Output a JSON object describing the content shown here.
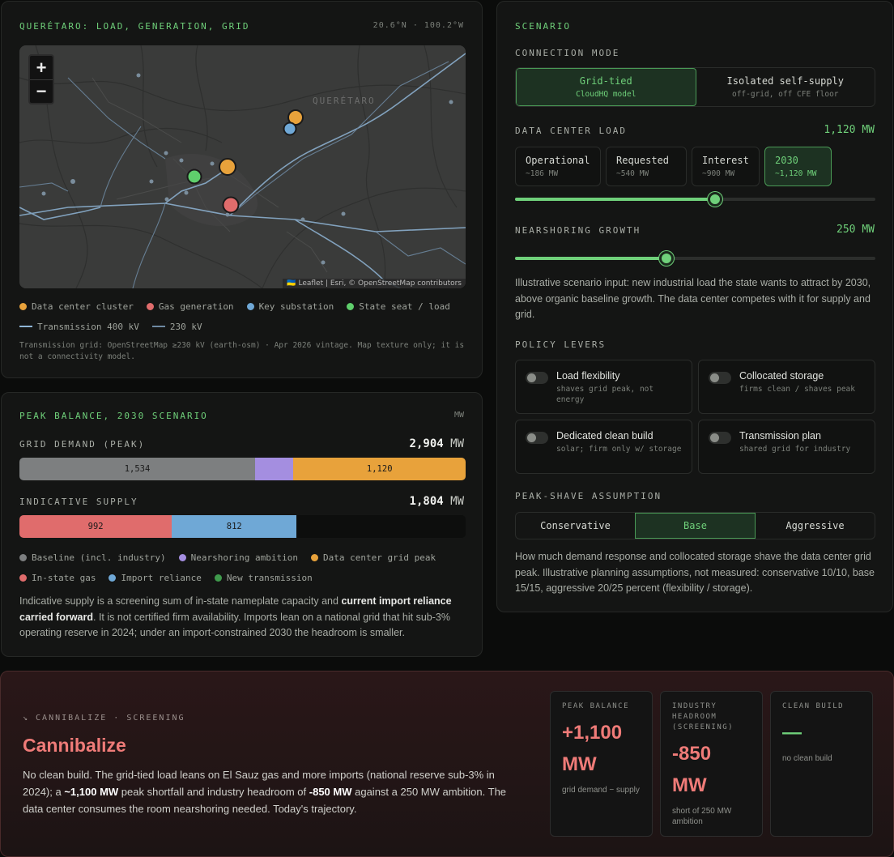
{
  "map_panel": {
    "title": "QUERÉTARO: LOAD, GENERATION, GRID",
    "coords": "20.6°N · 100.2°W",
    "map_place_label": "QUERÉTARO",
    "zoom_in": "+",
    "zoom_out": "−",
    "attribution": "🇺🇦 Leaflet | Esri, © OpenStreetMap contributors",
    "legend": [
      {
        "label": "Data center cluster",
        "color": "#e8a23b"
      },
      {
        "label": "Gas generation",
        "color": "#e06c6c"
      },
      {
        "label": "Key substation",
        "color": "#6fa8d6"
      },
      {
        "label": "State seat / load",
        "color": "#5fcf6c"
      }
    ],
    "line_legend": [
      {
        "label": "Transmission 400 kV",
        "color": "#8fb5d6"
      },
      {
        "label": "230 kV",
        "color": "#6e8aa3"
      }
    ],
    "note": "Transmission grid: OpenStreetMap ≥230 kV (earth-osm) · Apr 2026 vintage. Map texture only; it is not a connectivity model."
  },
  "peak_panel": {
    "title": "PEAK BALANCE, 2030 SCENARIO",
    "unit": "MW",
    "demand_label": "GRID DEMAND (PEAK)",
    "demand_total": "2,904",
    "demand_unit": "MW",
    "demand_segments": [
      {
        "name": "Baseline (incl. industry)",
        "value": 1534,
        "label": "1,534",
        "color": "#7d7f80"
      },
      {
        "name": "Nearshoring ambition",
        "value": 250,
        "label": "",
        "color": "#a48ee0"
      },
      {
        "name": "Data center grid peak",
        "value": 1120,
        "label": "1,120",
        "color": "#e8a23b"
      }
    ],
    "demand_scale_max": 2904,
    "supply_label": "INDICATIVE SUPPLY",
    "supply_total": "1,804",
    "supply_unit": "MW",
    "supply_segments": [
      {
        "name": "In-state gas",
        "value": 992,
        "label": "992",
        "color": "#e06c6c"
      },
      {
        "name": "Import reliance",
        "value": 812,
        "label": "812",
        "color": "#6fa8d6"
      }
    ],
    "legend_row1": [
      {
        "label": "Baseline (incl. industry)",
        "color": "#7d7f80"
      },
      {
        "label": "Nearshoring ambition",
        "color": "#a48ee0"
      },
      {
        "label": "Data center grid peak",
        "color": "#e8a23b"
      }
    ],
    "legend_row2": [
      {
        "label": "In-state gas",
        "color": "#e06c6c"
      },
      {
        "label": "Import reliance",
        "color": "#6fa8d6"
      },
      {
        "label": "New transmission",
        "color": "#3f9a4c"
      }
    ],
    "para_pre": "Indicative supply is a screening sum of in-state nameplate capacity and ",
    "para_bold": "current import reliance carried forward",
    "para_post": ". It is not certified firm availability. Imports lean on a national grid that hit sub-3% operating reserve in 2024; under an import-constrained 2030 the headroom is smaller."
  },
  "scenario": {
    "title": "SCENARIO",
    "connection_label": "CONNECTION MODE",
    "connection_options": [
      {
        "title": "Grid-tied",
        "sub": "CloudHQ model",
        "active": true
      },
      {
        "title": "Isolated self-supply",
        "sub": "off-grid, off CFE floor",
        "active": false
      }
    ],
    "load_label": "DATA CENTER LOAD",
    "load_value": "1,120 MW",
    "load_options": [
      {
        "title": "Operational",
        "sub": "~186 MW",
        "active": false
      },
      {
        "title": "Requested",
        "sub": "~540 MW",
        "active": false
      },
      {
        "title": "Interest",
        "sub": "~900 MW",
        "active": false
      },
      {
        "title": "2030",
        "sub": "~1,120 MW",
        "active": true
      }
    ],
    "load_slider_fraction": 0.555,
    "nearshoring_label": "NEARSHORING GROWTH",
    "nearshoring_value": "250 MW",
    "nearshoring_slider_fraction": 0.42,
    "nearshoring_desc": "Illustrative scenario input: new industrial load the state wants to attract by 2030, above organic baseline growth. The data center competes with it for supply and grid.",
    "levers_label": "POLICY LEVERS",
    "levers": [
      {
        "title": "Load flexibility",
        "sub": "shaves grid peak, not energy",
        "on": false
      },
      {
        "title": "Collocated storage",
        "sub": "firms clean / shaves peak",
        "on": false
      },
      {
        "title": "Dedicated clean build",
        "sub": "solar; firm only w/ storage",
        "on": false
      },
      {
        "title": "Transmission plan",
        "sub": "shared grid for industry",
        "on": false
      }
    ],
    "shave_label": "PEAK-SHAVE ASSUMPTION",
    "shave_options": [
      {
        "label": "Conservative",
        "active": false
      },
      {
        "label": "Base",
        "active": true
      },
      {
        "label": "Aggressive",
        "active": false
      }
    ],
    "shave_desc": "How much demand response and collocated storage shave the data center grid peak. Illustrative planning assumptions, not measured: conservative 10/10, base 15/15, aggressive 20/25 percent (flexibility / storage)."
  },
  "verdict": {
    "tag": "↘ CANNIBALIZE · SCREENING",
    "title": "Cannibalize",
    "desc_1": "No clean build. The grid-tied load leans on El Sauz gas and more imports (national reserve sub-3% in 2024); a ",
    "desc_b1": "~1,100 MW",
    "desc_2": " peak shortfall and industry headroom of ",
    "desc_b2": "-850 MW",
    "desc_3": " against a 250 MW ambition. The data center consumes the room nearshoring needed. Today's trajectory.",
    "stats": [
      {
        "head": "PEAK BALANCE",
        "value": "+1,100 MW",
        "sub": "grid demand − supply",
        "color": "#ef7b78"
      },
      {
        "head": "INDUSTRY HEADROOM (SCREENING)",
        "value": "-850 MW",
        "sub": "short of 250 MW ambition",
        "color": "#ef7b78"
      },
      {
        "head": "CLEAN BUILD",
        "value": "—",
        "sub": "no clean build",
        "color": "#6fd07a"
      }
    ]
  }
}
